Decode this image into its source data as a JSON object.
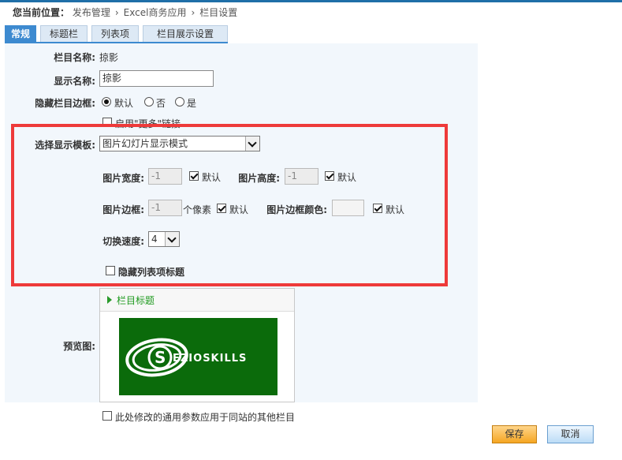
{
  "breadcrumb": {
    "prefix": "您当前位置：",
    "items": [
      "发布管理",
      "Excel商务应用",
      "栏目设置"
    ],
    "sep": "›"
  },
  "tabs": [
    {
      "label": "常规"
    },
    {
      "label": "标题栏"
    },
    {
      "label": "列表项"
    },
    {
      "label": "栏目展示设置"
    }
  ],
  "form": {
    "column_name_label": "栏目名称:",
    "column_name_value": "掠影",
    "display_name_label": "显示名称:",
    "display_name_value": "掠影",
    "hide_border_label": "隐藏栏目边框:",
    "hide_border_options": [
      "默认",
      "否",
      "是"
    ],
    "enable_more_label": "启用\"更多\"链接",
    "template_label": "选择显示模板:",
    "template_value": "图片幻灯片显示模式",
    "img_width_label": "图片宽度:",
    "img_width_value": "-1",
    "img_height_label": "图片高度:",
    "img_height_value": "-1",
    "default_label": "默认",
    "img_border_label": "图片边框:",
    "img_border_value": "-1",
    "pixel_unit": "个像素",
    "img_border_color_label": "图片边框颜色:",
    "switch_speed_label": "切换速度:",
    "switch_speed_value": "4",
    "hide_list_title_label": "隐藏列表项标题",
    "preview_label": "预览图:",
    "preview_title": "栏目标题",
    "apply_all_label": "此处修改的通用参数应用于同站的其他栏目"
  },
  "logo": {
    "text": "EZIOSKILLS",
    "letter": "S"
  },
  "buttons": {
    "save": "保存",
    "cancel": "取消"
  }
}
